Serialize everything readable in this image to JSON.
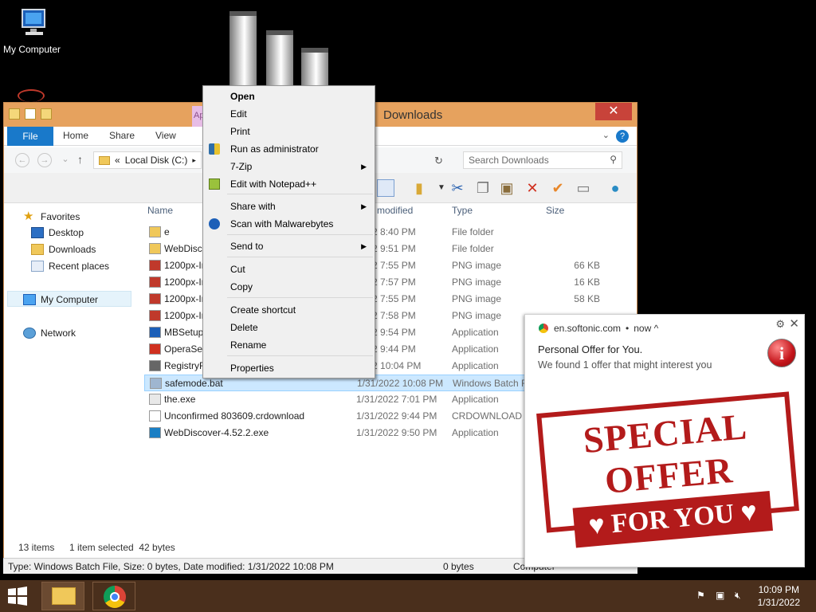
{
  "desktop": {
    "icons": [
      {
        "label": "My Computer"
      }
    ]
  },
  "explorer": {
    "title": "Downloads",
    "app_tools_tab": "Ap",
    "tabs": {
      "file": "File",
      "home": "Home",
      "share": "Share",
      "view": "View"
    },
    "address": {
      "chevron": "«",
      "path": "Local Disk (C:)",
      "sep": "▸"
    },
    "search_placeholder": "Search Downloads",
    "nav": {
      "favorites": "Favorites",
      "desktop": "Desktop",
      "downloads": "Downloads",
      "recent": "Recent places",
      "my_computer": "My Computer",
      "network": "Network"
    },
    "columns": {
      "name": "Name",
      "modified": "modified",
      "type": "Type",
      "size": "Size"
    },
    "files": [
      {
        "name": "e",
        "date": "2022 8:40 PM",
        "type": "File folder",
        "size": "",
        "icon": "folder-icon"
      },
      {
        "name": "WebDisco",
        "date": "2022 9:51 PM",
        "type": "File folder",
        "size": "",
        "icon": "folder-icon"
      },
      {
        "name": "1200px-Ir",
        "date": "2022 7:55 PM",
        "type": "PNG image",
        "size": "66 KB",
        "icon": "image-icon"
      },
      {
        "name": "1200px-Ir",
        "date": "2022 7:57 PM",
        "type": "PNG image",
        "size": "16 KB",
        "icon": "image-icon"
      },
      {
        "name": "1200px-Ir",
        "date": "2022 7:55 PM",
        "type": "PNG image",
        "size": "58 KB",
        "icon": "image-icon"
      },
      {
        "name": "1200px-Ir",
        "date": "2022 7:58 PM",
        "type": "PNG image",
        "size": "",
        "icon": "image-icon"
      },
      {
        "name": "MBSetup",
        "date": "2022 9:54 PM",
        "type": "Application",
        "size": "",
        "icon": "malwarebytes-icon"
      },
      {
        "name": "OperaSet",
        "date": "2022 9:44 PM",
        "type": "Application",
        "size": "",
        "icon": "opera-icon"
      },
      {
        "name": "RegistryF",
        "date": "2022 10:04 PM",
        "type": "Application",
        "size": "",
        "icon": "app-icon"
      },
      {
        "name": "safemode.bat",
        "date": "1/31/2022 10:08 PM",
        "type": "Windows Batch F",
        "size": "",
        "icon": "batch-file-icon"
      },
      {
        "name": "the.exe",
        "date": "1/31/2022 7:01 PM",
        "type": "Application",
        "size": "",
        "icon": "exe-icon"
      },
      {
        "name": "Unconfirmed 803609.crdownload",
        "date": "1/31/2022 9:44 PM",
        "type": "CRDOWNLOAD F",
        "size": "",
        "icon": "blank-file-icon"
      },
      {
        "name": "WebDiscover-4.52.2.exe",
        "date": "1/31/2022 9:50 PM",
        "type": "Application",
        "size": "",
        "icon": "webdiscover-icon"
      }
    ],
    "status": {
      "count": "13 items",
      "selected": "1 item selected  42 bytes"
    },
    "details": {
      "info": "Type: Windows Batch File, Size: 0 bytes, Date modified: 1/31/2022 10:08 PM",
      "size": "0 bytes",
      "location": "Computer"
    }
  },
  "context_menu": {
    "items": [
      {
        "label": "Open",
        "bold": true
      },
      {
        "label": "Edit"
      },
      {
        "label": "Print"
      },
      {
        "label": "Run as administrator",
        "icon": "shield-icon"
      },
      {
        "label": "7-Zip",
        "submenu": "▶"
      },
      {
        "label": "Edit with Notepad++",
        "icon": "notepad-plus-icon"
      },
      {
        "label": "Share with",
        "submenu": "▶"
      },
      {
        "label": "Scan with Malwarebytes",
        "icon": "malwarebytes-icon"
      },
      {
        "label": "Send to",
        "submenu": "▶"
      },
      {
        "label": "Cut"
      },
      {
        "label": "Copy"
      },
      {
        "label": "Create shortcut"
      },
      {
        "label": "Delete"
      },
      {
        "label": "Rename"
      },
      {
        "label": "Properties"
      }
    ]
  },
  "notification": {
    "source": "en.softonic.com",
    "dot": "•",
    "time": "now ^",
    "title": "Personal Offer for You.",
    "message": "We found 1 offer that might interest you",
    "badge": "i",
    "stamp_line1": "SPECIAL OFFER",
    "stamp_line2": "♥ FOR YOU ♥"
  },
  "taskbar": {
    "time": "10:09 PM",
    "date": "1/31/2022"
  },
  "colors": {
    "accent": "#1979ca",
    "titlebar": "#e6a25e",
    "taskbar": "#4a2f1c",
    "close": "#c8433a",
    "stamp": "#b31b1b"
  }
}
